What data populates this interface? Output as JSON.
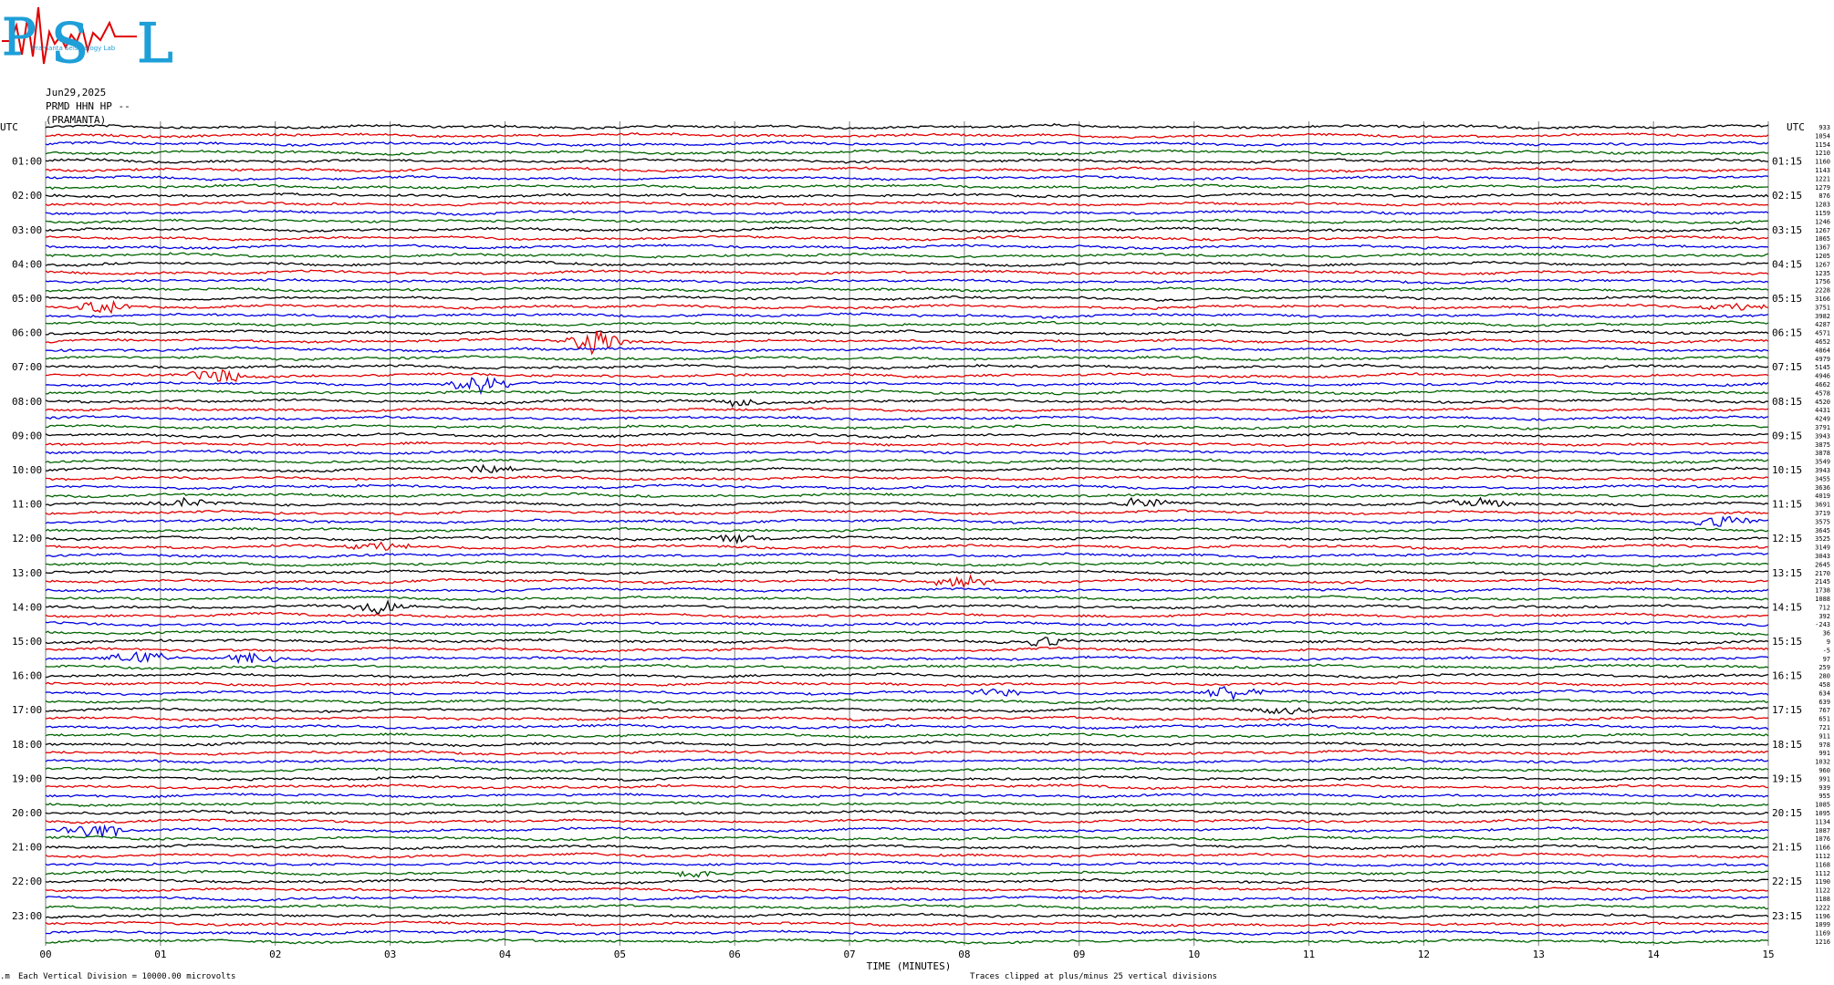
{
  "logo": {
    "letters": "PSL",
    "small_text": "Pramanta Seismology Lab"
  },
  "header": {
    "date": "Jun29,2025",
    "station_line": "PRMD HHN HP --",
    "station_name": "(PRAMANTA)"
  },
  "colors": {
    "trace": [
      "#000000",
      "#e00000",
      "#0000e0",
      "#006400"
    ],
    "grid": "#7a7a7a"
  },
  "chart_data": {
    "type": "line",
    "title": "",
    "xlabel": "TIME (MINUTES)",
    "xlim": [
      0,
      15
    ],
    "x_ticks": [
      "00",
      "01",
      "02",
      "03",
      "04",
      "05",
      "06",
      "07",
      "08",
      "09",
      "10",
      "11",
      "12",
      "13",
      "14",
      "15"
    ],
    "grid": "vertical lines every 1 minute",
    "left_axis_label": "UTC",
    "right_axis_label": "UTC",
    "rows_per_hour": 4,
    "row_minutes": 15,
    "left_hour_labels": [
      "01:00",
      "02:00",
      "03:00",
      "04:00",
      "05:00",
      "06:00",
      "07:00",
      "08:00",
      "09:00",
      "10:00",
      "11:00",
      "12:00",
      "13:00",
      "14:00",
      "15:00",
      "16:00",
      "17:00",
      "18:00",
      "19:00",
      "20:00",
      "21:00",
      "22:00",
      "23:00"
    ],
    "right_hour_labels": [
      "01:15",
      "02:15",
      "03:15",
      "04:15",
      "05:15",
      "06:15",
      "07:15",
      "08:15",
      "09:15",
      "10:15",
      "11:15",
      "12:15",
      "13:15",
      "14:15",
      "15:15",
      "16:15",
      "17:15",
      "18:15",
      "19:15",
      "20:15",
      "21:15",
      "22:15",
      "23:15"
    ],
    "right_values": [
      "933",
      "1054",
      "1154",
      "1210",
      "1160",
      "1143",
      "1221",
      "1279",
      "876",
      "1283",
      "1159",
      "1246",
      "1267",
      "1065",
      "1367",
      "1205",
      "1267",
      "1235",
      "1756",
      "2228",
      "3166",
      "3751",
      "3982",
      "4287",
      "4571",
      "4652",
      "4864",
      "4979",
      "5145",
      "4946",
      "4662",
      "4578",
      "4520",
      "4431",
      "4249",
      "3791",
      "3943",
      "3875",
      "3878",
      "3549",
      "3943",
      "3455",
      "3636",
      "4019",
      "3691",
      "3719",
      "3575",
      "3645",
      "3525",
      "3149",
      "3043",
      "2645",
      "2170",
      "2145",
      "1738",
      "1088",
      "712",
      "392",
      "-243",
      "36",
      "9",
      "-5",
      "97",
      "259",
      "280",
      "458",
      "634",
      "639",
      "767",
      "651",
      "721",
      "911",
      "978",
      "991",
      "1032",
      "960",
      "991",
      "939",
      "955",
      "1085",
      "1095",
      "1134",
      "1087",
      "1076",
      "1166",
      "1112",
      "1168",
      "1112",
      "1190",
      "1122",
      "1188",
      "1222",
      "1196",
      "1099",
      "1169",
      "1216"
    ],
    "events": [
      {
        "row": 21,
        "minute": 0.5,
        "amp": 0.9
      },
      {
        "row": 21,
        "minute": 14.7,
        "amp": 0.5
      },
      {
        "row": 25,
        "minute": 4.8,
        "amp": 1.6
      },
      {
        "row": 29,
        "minute": 1.5,
        "amp": 0.8
      },
      {
        "row": 30,
        "minute": 3.8,
        "amp": 1.1
      },
      {
        "row": 32,
        "minute": 6.0,
        "amp": 0.5
      },
      {
        "row": 40,
        "minute": 3.9,
        "amp": 0.7
      },
      {
        "row": 44,
        "minute": 1.2,
        "amp": 0.6
      },
      {
        "row": 44,
        "minute": 9.5,
        "amp": 0.6
      },
      {
        "row": 44,
        "minute": 12.5,
        "amp": 0.7
      },
      {
        "row": 46,
        "minute": 14.6,
        "amp": 0.7
      },
      {
        "row": 48,
        "minute": 6.0,
        "amp": 0.6
      },
      {
        "row": 49,
        "minute": 2.9,
        "amp": 0.6
      },
      {
        "row": 53,
        "minute": 8.0,
        "amp": 0.8
      },
      {
        "row": 56,
        "minute": 2.9,
        "amp": 0.9
      },
      {
        "row": 60,
        "minute": 8.7,
        "amp": 0.6
      },
      {
        "row": 62,
        "minute": 0.8,
        "amp": 0.9
      },
      {
        "row": 62,
        "minute": 1.8,
        "amp": 0.7
      },
      {
        "row": 66,
        "minute": 8.3,
        "amp": 0.5
      },
      {
        "row": 66,
        "minute": 10.3,
        "amp": 0.9
      },
      {
        "row": 68,
        "minute": 10.8,
        "amp": 0.5
      },
      {
        "row": 82,
        "minute": 0.4,
        "amp": 1.2
      },
      {
        "row": 87,
        "minute": 5.6,
        "amp": 0.5
      }
    ]
  },
  "footer": {
    "left_note": "Each Vertical Division = 10000.00 microvolts",
    "center_note": "Traces clipped at plus/minus 25 vertical divisions"
  }
}
